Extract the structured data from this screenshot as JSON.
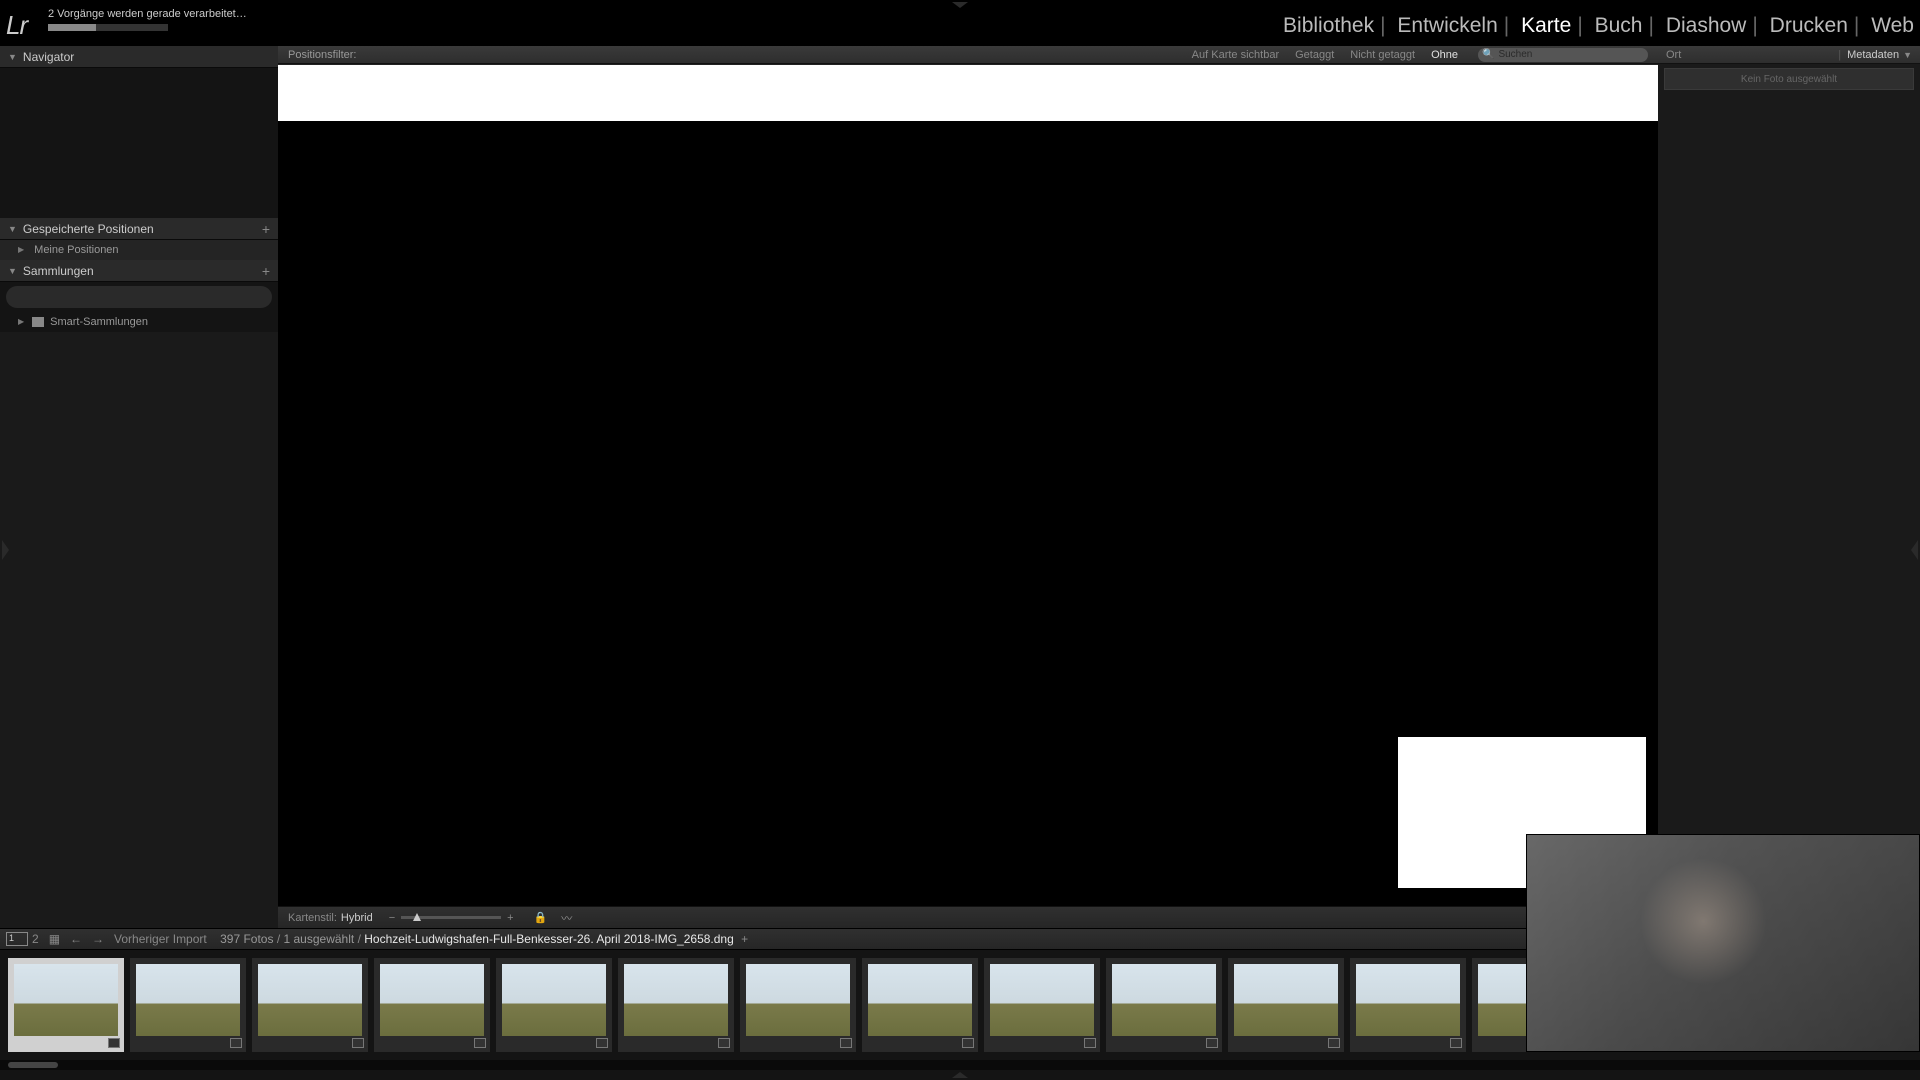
{
  "topbar": {
    "logo": "Lr",
    "status": "2 Vorgänge werden gerade verarbeitet…"
  },
  "modules": {
    "bibliothek": "Bibliothek",
    "entwickeln": "Entwickeln",
    "karte": "Karte",
    "buch": "Buch",
    "diashow": "Diashow",
    "drucken": "Drucken",
    "web": "Web"
  },
  "left": {
    "navigator": "Navigator",
    "saved_locations": "Gespeicherte Positionen",
    "my_locations": "Meine Positionen",
    "collections": "Sammlungen",
    "smart_collections": "Smart-Sammlungen"
  },
  "filterbar": {
    "label": "Positionsfilter:",
    "visible": "Auf Karte sichtbar",
    "tagged": "Getaggt",
    "untagged": "Nicht getaggt",
    "none": "Ohne",
    "search_ph": "Suchen"
  },
  "mapctrl": {
    "style_label": "Kartenstil:",
    "style_value": "Hybrid"
  },
  "right": {
    "location_label": "Ort",
    "metadata": "Metadaten",
    "empty": "Kein Foto ausgewählt"
  },
  "filmstrip": {
    "second_monitor": "2",
    "prev_import": "Vorheriger Import",
    "count": "397 Fotos",
    "selected": "1 ausgewählt",
    "filename": "Hochzeit-Ludwigshafen-Full-Benkesser-26. April 2018-IMG_2658.dng",
    "modified": "+"
  }
}
